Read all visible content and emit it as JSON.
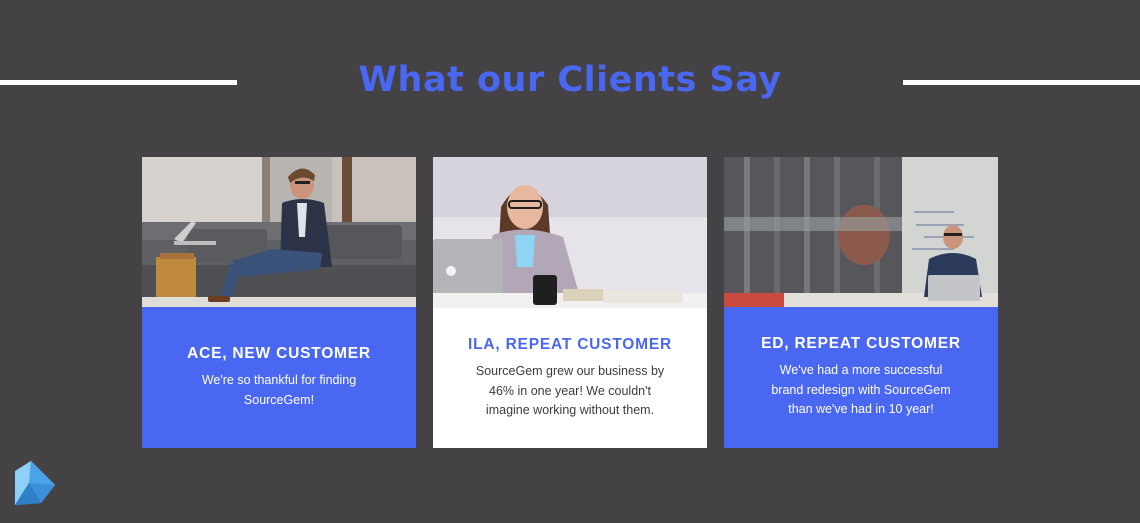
{
  "section": {
    "title": "What our Clients Say"
  },
  "testimonials": [
    {
      "name": "ACE, NEW CUSTOMER",
      "quote_lines": [
        "We're so thankful for finding",
        "SourceGem!"
      ],
      "style": "blue"
    },
    {
      "name": "ILA, REPEAT CUSTOMER",
      "quote_lines": [
        "SourceGem grew our business by",
        "46% in one year! We couldn't",
        "imagine working without them."
      ],
      "style": "white"
    },
    {
      "name": "ED, REPEAT CUSTOMER",
      "quote_lines": [
        "We've had a more successful",
        "brand redesign with SourceGem",
        "than we've had in 10 year!"
      ],
      "style": "blue"
    }
  ],
  "colors": {
    "background": "#444244",
    "accent": "#4a67f2",
    "white": "#ffffff",
    "body_text_dark": "#3c3c3c"
  },
  "icons": {
    "logo": "gem-logo-icon"
  }
}
